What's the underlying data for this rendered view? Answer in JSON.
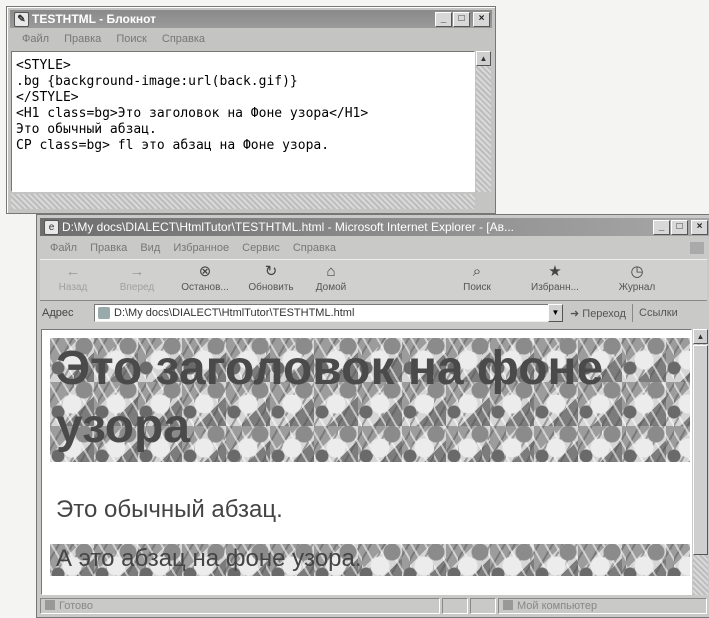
{
  "notepad": {
    "title": "TESTHTML - Блокнот",
    "menu": [
      "Файл",
      "Правка",
      "Поиск",
      "Справка"
    ],
    "lines": [
      "<STYLE>",
      ".bg {background-image:url(back.gif)}",
      "</STYLE>",
      "",
      "<H1 class=bg>Это заголовок на Фоне узора</H1>",
      "Это обычный абзац.",
      "CP class=bg> fl это абзац на Фоне узора."
    ]
  },
  "ie": {
    "title": "D:\\My docs\\DIALECT\\HtmlTutor\\TESTHTML.html - Microsoft Internet Explorer - [Ав...",
    "menu": [
      "Файл",
      "Правка",
      "Вид",
      "Избранное",
      "Сервис",
      "Справка"
    ],
    "toolbar": [
      {
        "label": "Назад",
        "icon": "back-arrow",
        "enabled": false
      },
      {
        "label": "Вперед",
        "icon": "forward-arrow",
        "enabled": false
      },
      {
        "label": "Останов...",
        "icon": "stop",
        "enabled": true
      },
      {
        "label": "Обновить",
        "icon": "refresh",
        "enabled": true
      },
      {
        "label": "Домой",
        "icon": "home",
        "enabled": true
      },
      {
        "label": "Поиск",
        "icon": "search",
        "enabled": true
      },
      {
        "label": "Избранн...",
        "icon": "favorites",
        "enabled": true
      },
      {
        "label": "Журнал",
        "icon": "history",
        "enabled": true
      }
    ],
    "address": {
      "label": "Адрес",
      "url": "D:\\My docs\\DIALECT\\HtmlTutor\\TESTHTML.html",
      "go": "Переход",
      "links": "Ссылки"
    },
    "page": {
      "heading": "Это заголовок на фоне узора",
      "para": "Это обычный абзац.",
      "para_bg": "А это абзац на фоне узора."
    },
    "status": {
      "left": "Готово",
      "zone": "Мой компьютер"
    }
  }
}
